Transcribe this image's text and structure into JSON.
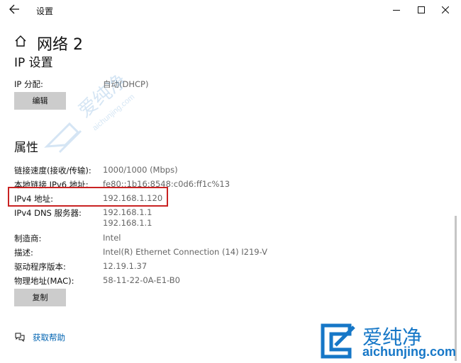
{
  "window": {
    "title": "设置"
  },
  "page": {
    "title": "网络 2"
  },
  "ip_settings": {
    "section_title": "IP 设置",
    "assignment_label": "IP 分配:",
    "assignment_value": "自动(DHCP)",
    "edit_button": "编辑"
  },
  "properties": {
    "section_title": "属性",
    "rows": [
      {
        "label": "链接速度(接收/传输):",
        "value": "1000/1000 (Mbps)"
      },
      {
        "label": "本地链接 IPv6 地址:",
        "value": "fe80::1b16:8548:c0d6:ff1c%13"
      },
      {
        "label": "IPv4 地址:",
        "value": "192.168.1.120"
      },
      {
        "label": "IPv4 DNS 服务器:",
        "value": "192.168.1.1",
        "value2": "192.168.1.1"
      },
      {
        "label": "制造商:",
        "value": "Intel"
      },
      {
        "label": "描述:",
        "value": "Intel(R) Ethernet Connection (14) I219-V"
      },
      {
        "label": "驱动程序版本:",
        "value": "12.19.1.37"
      },
      {
        "label": "物理地址(MAC):",
        "value": "58-11-22-0A-E1-B0"
      }
    ],
    "copy_button": "复制"
  },
  "help": {
    "link_label": "获取帮助"
  },
  "watermark": {
    "name": "爱纯净",
    "url": "aichunjing.com"
  },
  "colors": {
    "highlight_border": "#c92222",
    "link": "#0063b1",
    "button_bg": "#cccccc",
    "watermark": "#1677c7"
  }
}
